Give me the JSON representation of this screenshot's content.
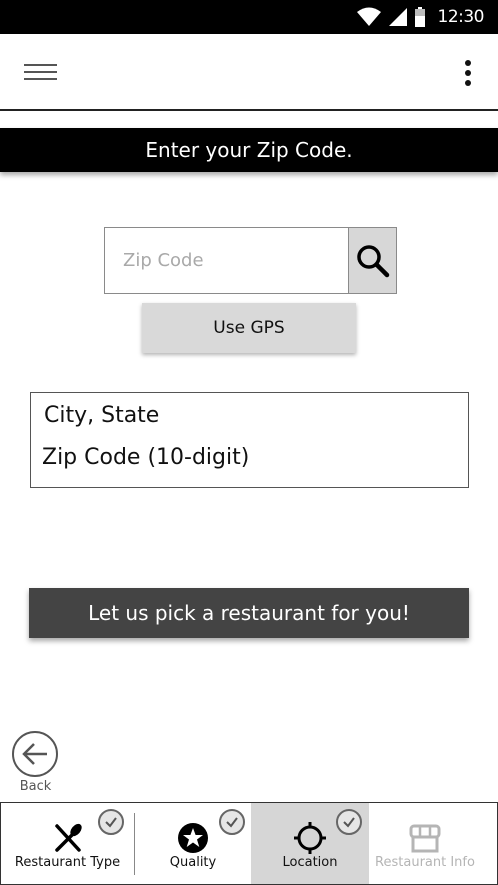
{
  "status_bar": {
    "time": "12:30",
    "icons": [
      "wifi-icon",
      "signal-icon",
      "battery-icon"
    ]
  },
  "app_bar": {
    "menu_icon": "hamburger-menu-icon",
    "more_icon": "more-vertical-icon"
  },
  "banner": {
    "text": "Enter your Zip Code."
  },
  "search": {
    "placeholder": "Zip Code",
    "value": "",
    "button_icon": "search-icon"
  },
  "gps_button": {
    "label": "Use GPS"
  },
  "location_card": {
    "city_state": "City, State",
    "zip": "Zip Code (10-digit)"
  },
  "pick_button": {
    "label": "Let us pick a restaurant for you!"
  },
  "back": {
    "label": "Back",
    "icon": "arrow-left-icon"
  },
  "bottom_nav": {
    "items": [
      {
        "label": "Restaurant Type",
        "icon": "fork-knife-icon",
        "checked": true,
        "active": false,
        "disabled": false
      },
      {
        "label": "Quality",
        "icon": "star-badge-icon",
        "checked": true,
        "active": false,
        "disabled": false
      },
      {
        "label": "Location",
        "icon": "crosshair-icon",
        "checked": true,
        "active": true,
        "disabled": false
      },
      {
        "label": "Restaurant Info",
        "icon": "storefront-icon",
        "checked": false,
        "active": false,
        "disabled": true
      }
    ]
  },
  "colors": {
    "status_bar": "#000000",
    "banner": "#000000",
    "pick_button": "#444444",
    "gps_button": "#d9d9d9",
    "active_tab": "#d6d6d6",
    "disabled_text": "#b5b5b5"
  }
}
